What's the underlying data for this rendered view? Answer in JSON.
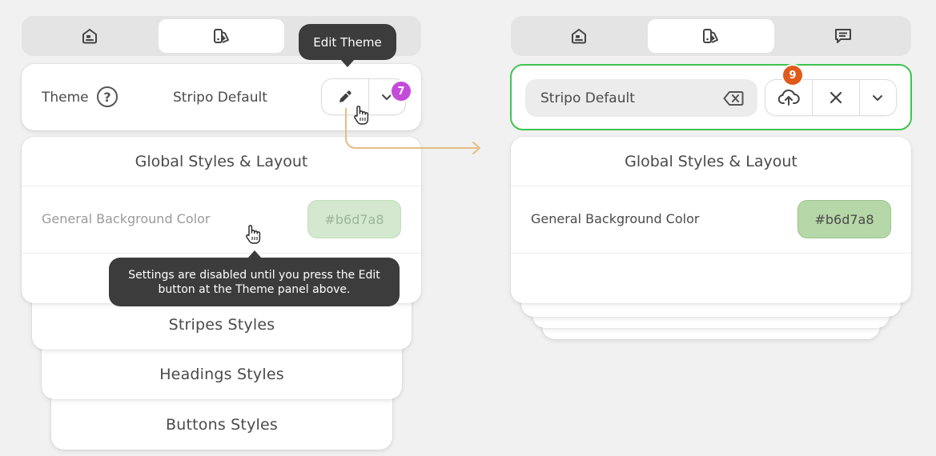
{
  "colors": {
    "accent_green": "#3fc451",
    "badge_purple": "#c44bd9",
    "badge_orange": "#e05a1b",
    "arrow": "#e6bd84",
    "chip_disabled_bg": "#d4e8cf",
    "chip_enabled_bg": "#b6d7a8"
  },
  "left": {
    "tabs": [
      {
        "icon": "email-icon"
      },
      {
        "icon": "theme-palette-icon",
        "active": true
      },
      {
        "icon": "comment-icon"
      }
    ],
    "theme_panel": {
      "label": "Theme",
      "help_icon": "?",
      "theme_name": "Stripo Default",
      "edit_icon": "pencil-icon",
      "dropdown_icon": "chevron-down-icon",
      "badge": "7"
    },
    "edit_tooltip": "Edit Theme",
    "global_styles": {
      "title": "Global Styles & Layout",
      "bg_label": "General Background Color",
      "bg_value": "#b6d7a8"
    },
    "disabled_tooltip_line1": "Settings are disabled until you press the Edit",
    "disabled_tooltip_line2": "button at the Theme panel above.",
    "stack": [
      "Stripes Styles",
      "Headings Styles",
      "Buttons Styles"
    ]
  },
  "right": {
    "tabs": [
      {
        "icon": "email-icon"
      },
      {
        "icon": "theme-palette-icon",
        "active": true
      },
      {
        "icon": "comment-icon"
      }
    ],
    "theme_panel": {
      "input_value": "Stripo Default",
      "clear_icon": "backspace-icon",
      "save_icon": "cloud-upload-icon",
      "close_icon": "close-icon",
      "dropdown_icon": "chevron-down-icon",
      "badge": "9"
    },
    "global_styles": {
      "title": "Global Styles & Layout",
      "bg_label": "General Background Color",
      "bg_value": "#b6d7a8"
    }
  }
}
